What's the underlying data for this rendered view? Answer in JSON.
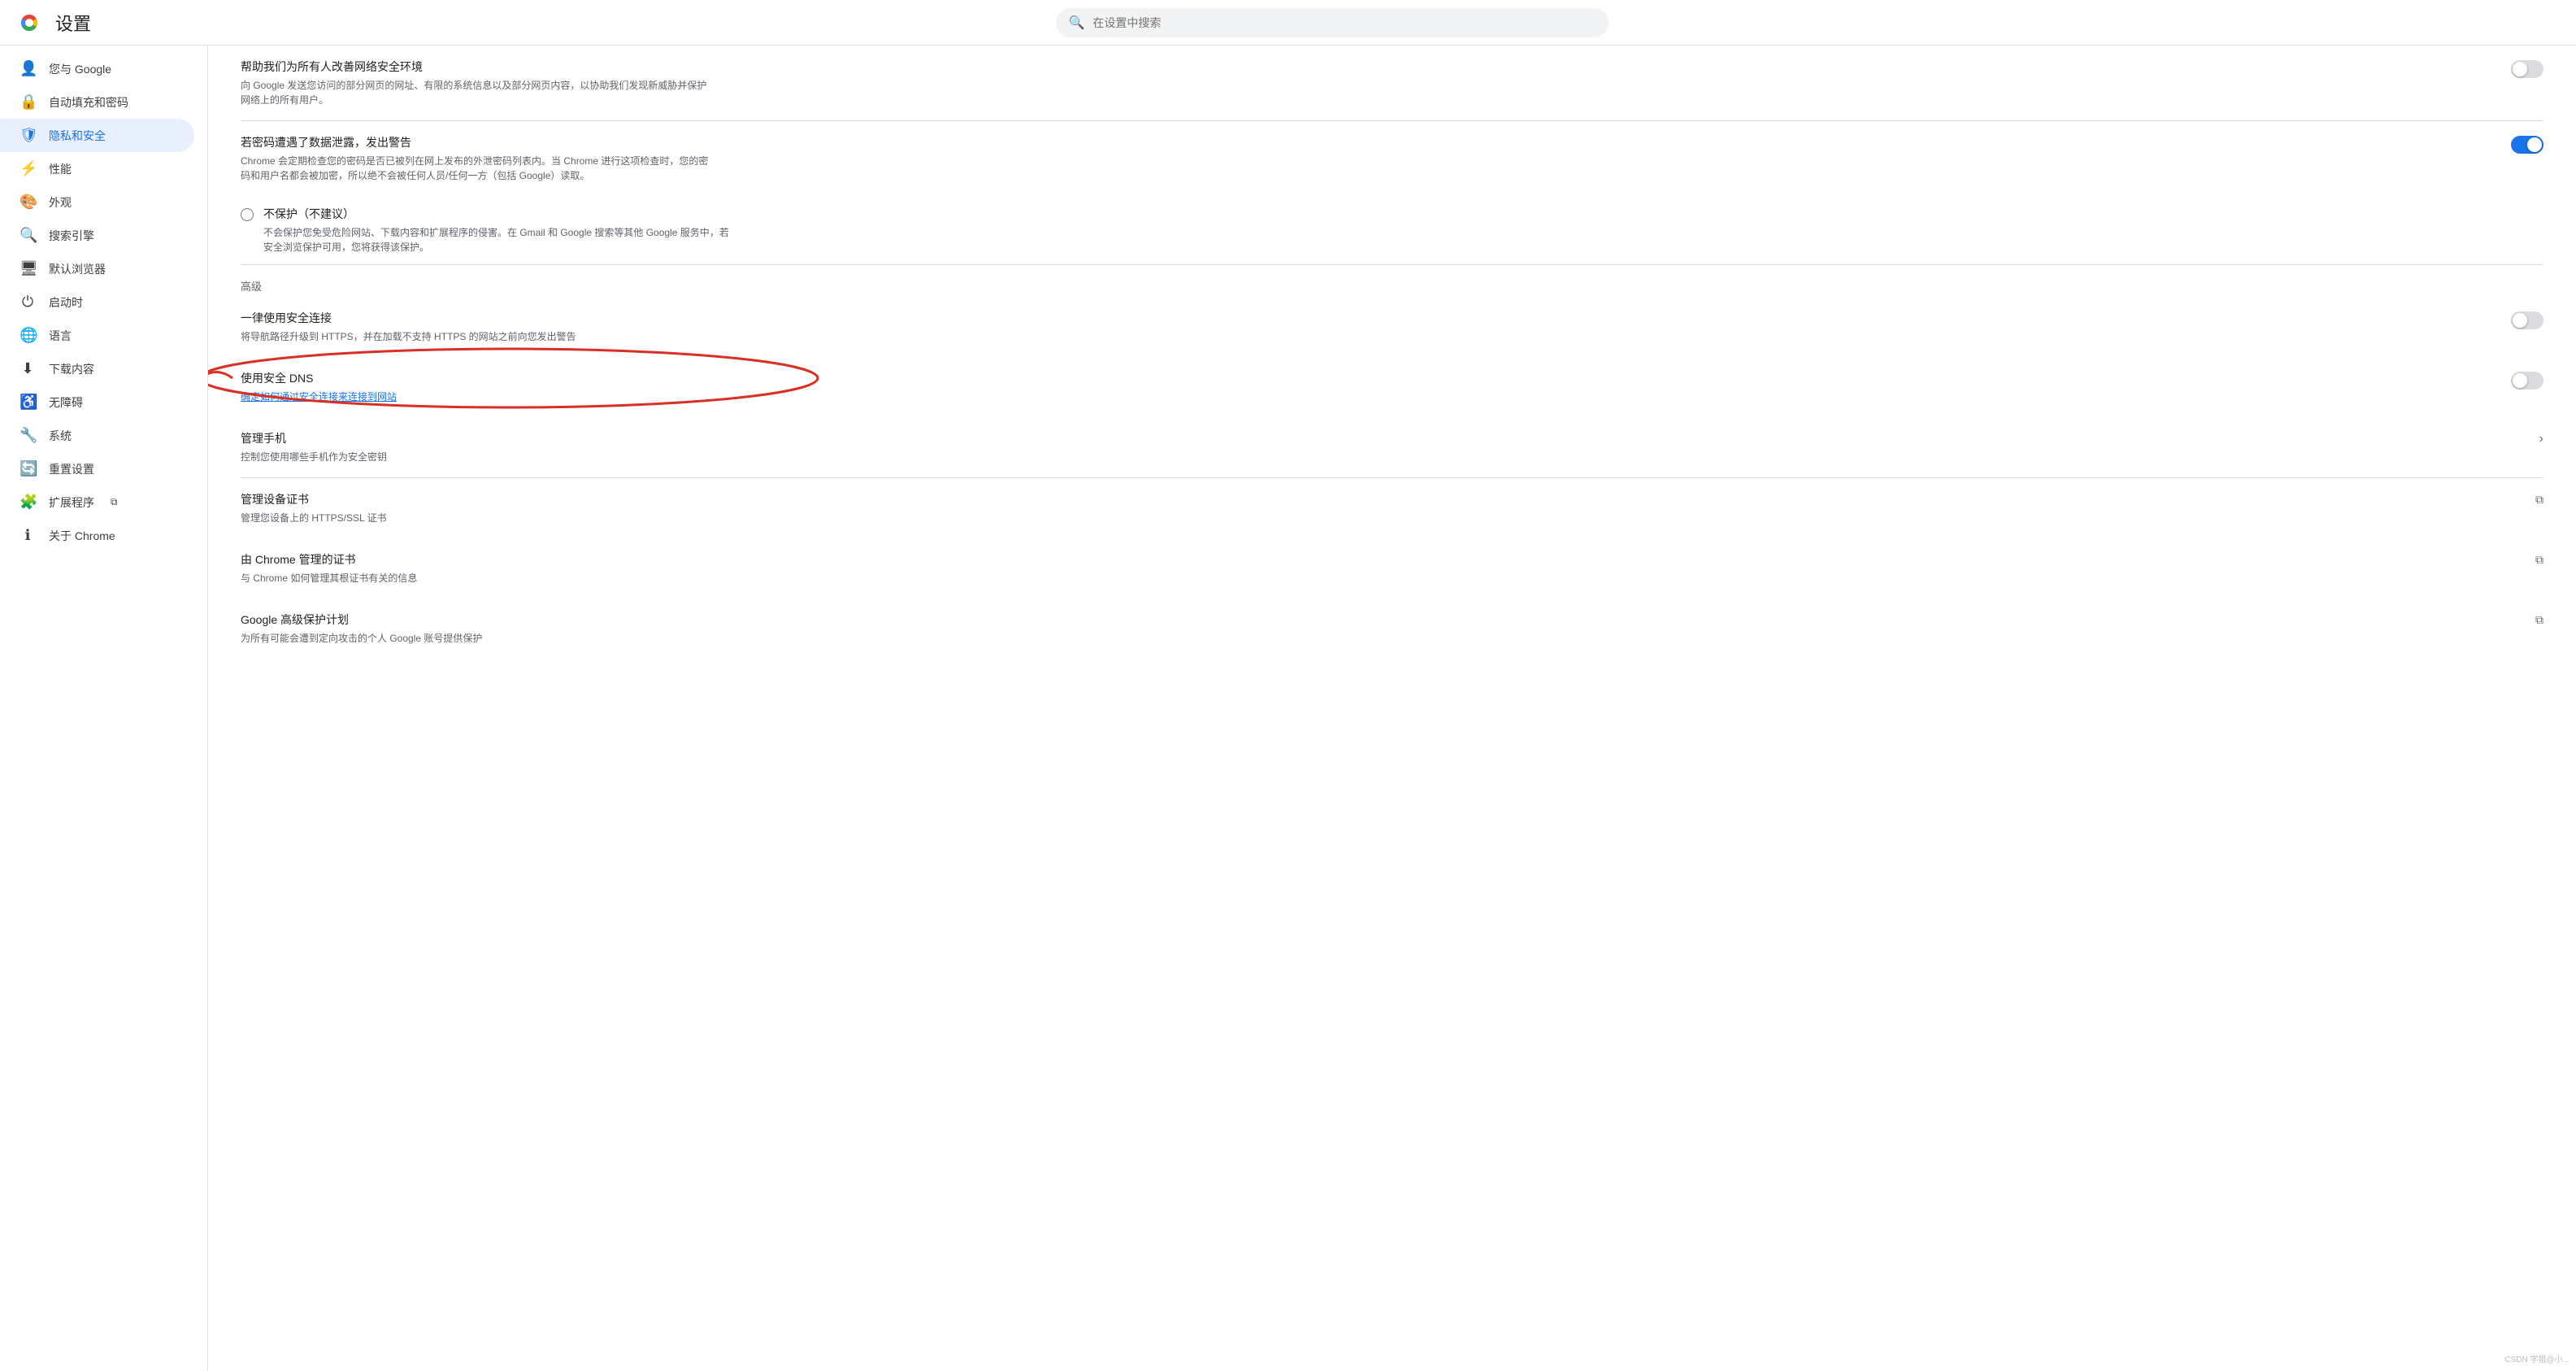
{
  "header": {
    "title": "设置",
    "search_placeholder": "在设置中搜索"
  },
  "sidebar": {
    "items": [
      {
        "id": "profile",
        "label": "您与 Google",
        "icon": "👤",
        "active": false
      },
      {
        "id": "autofill",
        "label": "自动填充和密码",
        "icon": "🔒",
        "active": false
      },
      {
        "id": "privacy",
        "label": "隐私和安全",
        "icon": "🛡",
        "active": true
      },
      {
        "id": "performance",
        "label": "性能",
        "icon": "⚡",
        "active": false
      },
      {
        "id": "appearance",
        "label": "外观",
        "icon": "🎨",
        "active": false
      },
      {
        "id": "search",
        "label": "搜索引擎",
        "icon": "🔍",
        "active": false
      },
      {
        "id": "default-browser",
        "label": "默认浏览器",
        "icon": "🖥",
        "active": false
      },
      {
        "id": "startup",
        "label": "启动时",
        "icon": "⏻",
        "active": false
      },
      {
        "id": "languages",
        "label": "语言",
        "icon": "🌐",
        "active": false
      },
      {
        "id": "downloads",
        "label": "下载内容",
        "icon": "⬇",
        "active": false
      },
      {
        "id": "accessibility",
        "label": "无障碍",
        "icon": "♿",
        "active": false
      },
      {
        "id": "system",
        "label": "系统",
        "icon": "🔧",
        "active": false
      },
      {
        "id": "reset",
        "label": "重置设置",
        "icon": "🔄",
        "active": false
      },
      {
        "id": "extensions",
        "label": "扩展程序",
        "icon": "🧩",
        "active": false
      },
      {
        "id": "about",
        "label": "关于 Chrome",
        "icon": "ℹ",
        "active": false
      }
    ]
  },
  "content": {
    "network_security": {
      "title": "帮助我们为所有人改善网络安全环境",
      "desc": "向 Google 发送您访问的部分网页的网址、有限的系统信息以及部分网页内容，以协助我们发现新威胁并保护网络上的所有用户。",
      "enabled": false
    },
    "password_breach": {
      "title": "若密码遭遇了数据泄露，发出警告",
      "desc": "Chrome 会定期检查您的密码是否已被列在网上发布的外泄密码列表内。当 Chrome 进行这项检查时，您的密码和用户名都会被加密，所以绝不会被任何人员/任何一方（包括 Google）读取。",
      "enabled": true
    },
    "no_protection": {
      "title": "不保护（不建议）",
      "desc": "不会保护您免受危险网站、下载内容和扩展程序的侵害。在 Gmail 和 Google 搜索等其他 Google 服务中，若安全浏览保护可用，您将获得该保护。",
      "selected": false
    },
    "advanced_heading": "高级",
    "https_only": {
      "title": "一律使用安全连接",
      "desc": "将导航路径升级到 HTTPS，并在加载不支持 HTTPS 的网站之前向您发出警告",
      "enabled": false
    },
    "secure_dns": {
      "title": "使用安全 DNS",
      "desc": "确定如何通过安全连接来连接到网站",
      "enabled": false
    },
    "manage_phone": {
      "title": "管理手机",
      "desc": "控制您使用哪些手机作为安全密钥",
      "has_arrow": true
    },
    "manage_certs": {
      "title": "管理设备证书",
      "desc": "管理您设备上的 HTTPS/SSL 证书",
      "has_external": true
    },
    "chrome_certs": {
      "title": "由 Chrome 管理的证书",
      "desc": "与 Chrome 如何管理其根证书有关的信息",
      "has_external": true
    },
    "google_protection": {
      "title": "Google 高级保护计划",
      "desc": "为所有可能会遭到定向攻击的个人 Google 账号提供保护",
      "has_external": true
    }
  },
  "watermark": "CSDN 学姐@小..."
}
